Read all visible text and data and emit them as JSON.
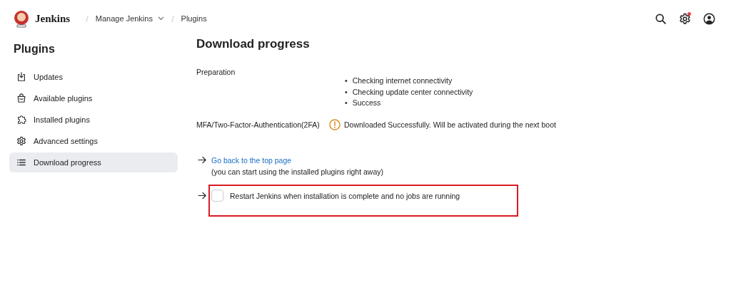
{
  "header": {
    "logo_text": "Jenkins",
    "notification": true,
    "separator": "/",
    "breadcrumbs": [
      {
        "label": "Manage Jenkins",
        "dropdown": true
      },
      {
        "label": "Plugins",
        "dropdown": false
      }
    ]
  },
  "sidebar": {
    "title": "Plugins",
    "items": [
      {
        "label": "Updates",
        "selected": false
      },
      {
        "label": "Available plugins",
        "selected": false
      },
      {
        "label": "Installed plugins",
        "selected": false
      },
      {
        "label": "Advanced settings",
        "selected": false
      },
      {
        "label": "Download progress",
        "selected": true
      }
    ]
  },
  "main": {
    "title": "Download progress",
    "rows": [
      {
        "kind": "list",
        "label": "Preparation",
        "bullet": "•",
        "items": [
          "Checking internet connectivity",
          "Checking update center connectivity",
          "Success"
        ]
      },
      {
        "kind": "warning",
        "label": "MFA/Two-Factor-Authentication(2FA)",
        "status": "Downloaded Successfully. Will be activated during the next boot"
      }
    ],
    "link": {
      "label": "Go back to the top page",
      "note": "(you can start using the installed plugins right away)"
    },
    "restart": {
      "label": "Restart Jenkins when installation is complete and no jobs are running",
      "checked": false,
      "highlighted": true
    }
  }
}
